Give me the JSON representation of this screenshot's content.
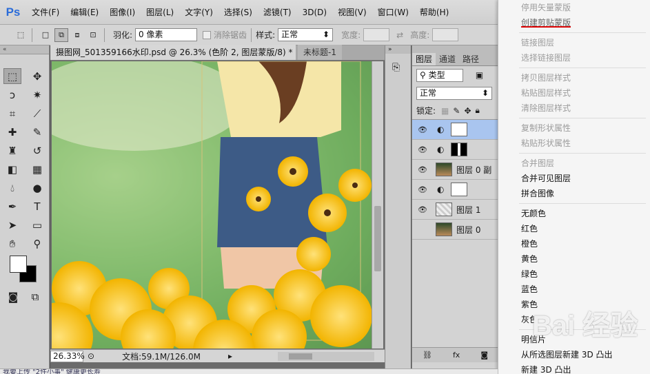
{
  "app": {
    "logo": "Ps"
  },
  "menubar": [
    "文件(F)",
    "编辑(E)",
    "图像(I)",
    "图层(L)",
    "文字(Y)",
    "选择(S)",
    "滤镜(T)",
    "3D(D)",
    "视图(V)",
    "窗口(W)",
    "帮助(H)"
  ],
  "options": {
    "feather_label": "羽化:",
    "feather_value": "0 像素",
    "antialias_label": "消除锯齿",
    "style_label": "样式:",
    "style_value": "正常",
    "width_label": "宽度:",
    "height_label": "高度:"
  },
  "tabs": [
    {
      "label": "摄图网_501359166水印.psd @ 26.3% (色阶 2, 图层蒙版/8) *",
      "close": "×"
    },
    {
      "label": "未标题-1"
    }
  ],
  "status": {
    "zoom": "26.33%",
    "doc": "文档:59.1M/126.0M"
  },
  "layers_panel": {
    "tabs": [
      "图层",
      "通道",
      "路径"
    ],
    "filter": "类型",
    "blend": "正常",
    "lock_label": "锁定:",
    "layers": [
      {
        "name": "",
        "selected": true,
        "visible": true,
        "icon": "adjustment-icon"
      },
      {
        "name": "",
        "selected": false,
        "visible": true,
        "icon": "adjustment-icon"
      },
      {
        "name": "图层 0 副",
        "selected": false,
        "visible": true
      },
      {
        "name": "",
        "selected": false,
        "visible": true,
        "icon": "adjustment-icon"
      },
      {
        "name": "图层 1",
        "selected": false,
        "visible": true
      },
      {
        "name": "图层 0",
        "selected": false,
        "visible": false
      }
    ]
  },
  "context_menu": [
    {
      "label": "停用矢量蒙版",
      "disabled": true
    },
    {
      "label": "创建剪贴蒙版",
      "disabled": true,
      "highlighted": true
    },
    {
      "sep": true
    },
    {
      "label": "链接图层",
      "disabled": true
    },
    {
      "label": "选择链接图层",
      "disabled": true
    },
    {
      "sep": true
    },
    {
      "label": "拷贝图层样式",
      "disabled": true
    },
    {
      "label": "粘贴图层样式",
      "disabled": true
    },
    {
      "label": "清除图层样式",
      "disabled": true
    },
    {
      "sep": true
    },
    {
      "label": "复制形状属性",
      "disabled": true
    },
    {
      "label": "粘贴形状属性",
      "disabled": true
    },
    {
      "sep": true
    },
    {
      "label": "合并图层",
      "disabled": true
    },
    {
      "label": "合并可见图层",
      "disabled": false
    },
    {
      "label": "拼合图像",
      "disabled": false
    },
    {
      "sep": true
    },
    {
      "label": "无颜色",
      "disabled": false
    },
    {
      "label": "红色",
      "disabled": false
    },
    {
      "label": "橙色",
      "disabled": false
    },
    {
      "label": "黄色",
      "disabled": false
    },
    {
      "label": "绿色",
      "disabled": false
    },
    {
      "label": "蓝色",
      "disabled": false
    },
    {
      "label": "紫色",
      "disabled": false
    },
    {
      "label": "灰色",
      "disabled": false
    },
    {
      "sep": true
    },
    {
      "label": "明信片",
      "disabled": false
    },
    {
      "label": "从所选图层新建 3D 凸出",
      "disabled": false
    },
    {
      "label": "新建 3D 凸出",
      "disabled": false
    }
  ],
  "taskbar": "我要上传 \"2件小事\"   健康更长寿",
  "watermark": "Bai 经验",
  "colors": {
    "menubar": "#d8d8d8",
    "selected_layer": "#a9c5ef",
    "disabled_text": "#9c9c9c"
  }
}
